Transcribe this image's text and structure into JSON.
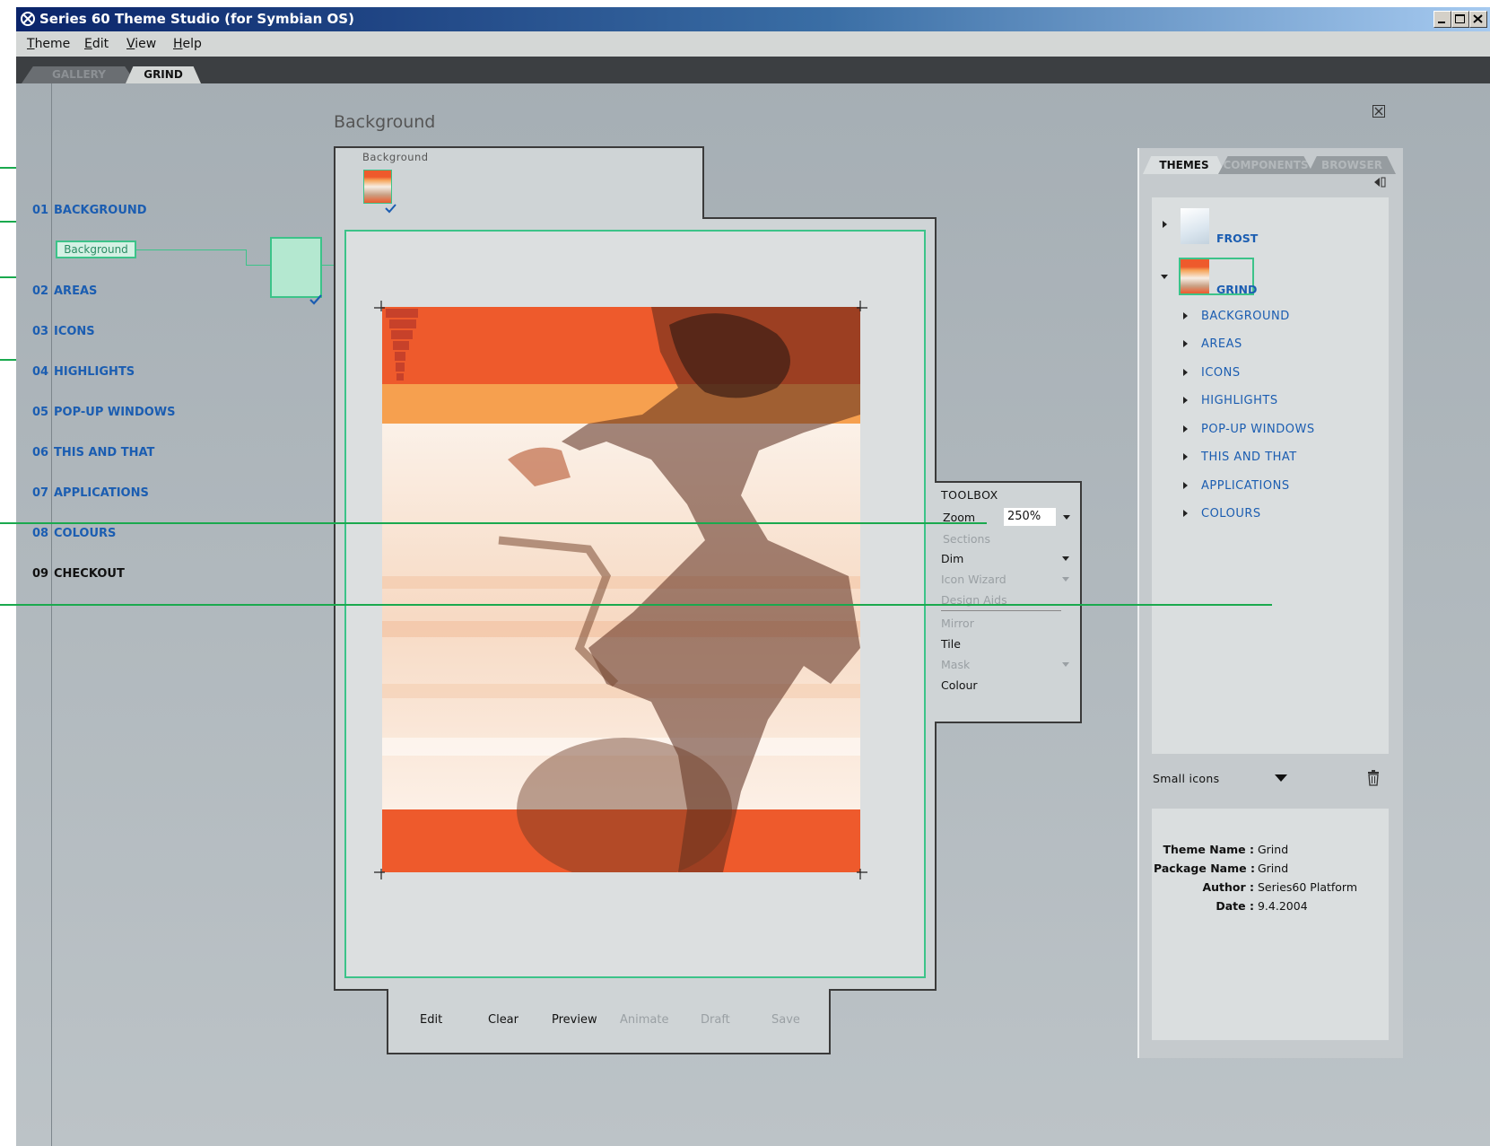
{
  "window": {
    "title": "Series 60 Theme Studio (for Symbian OS)"
  },
  "menu": [
    {
      "accel": "T",
      "rest": "heme"
    },
    {
      "accel": "E",
      "rest": "dit"
    },
    {
      "accel": "V",
      "rest": "iew"
    },
    {
      "accel": "H",
      "rest": "elp"
    }
  ],
  "doc_tabs": {
    "gallery": "GALLERY",
    "grind": "GRIND"
  },
  "nav": [
    {
      "num": "01",
      "label": "BACKGROUND"
    },
    {
      "num": "02",
      "label": "AREAS"
    },
    {
      "num": "03",
      "label": "ICONS"
    },
    {
      "num": "04",
      "label": "HIGHLIGHTS"
    },
    {
      "num": "05",
      "label": "POP-UP WINDOWS"
    },
    {
      "num": "06",
      "label": "THIS AND THAT"
    },
    {
      "num": "07",
      "label": "APPLICATIONS"
    },
    {
      "num": "08",
      "label": "COLOURS"
    },
    {
      "num": "09",
      "label": "CHECKOUT"
    }
  ],
  "tree_item": "Background",
  "page": {
    "heading": "Background",
    "thumb_label": "Background"
  },
  "toolbox": {
    "title": "TOOLBOX",
    "zoom_label": "Zoom",
    "zoom_value": "250%",
    "sections": "Sections",
    "dim": "Dim",
    "icon_wizard": "Icon Wizard",
    "design_aids": "Design Aids",
    "mirror": "Mirror",
    "tile": "Tile",
    "mask": "Mask",
    "colour": "Colour"
  },
  "bottom_buttons": {
    "edit": "Edit",
    "clear": "Clear",
    "preview": "Preview",
    "animate": "Animate",
    "draft": "Draft",
    "save": "Save"
  },
  "side_tabs": {
    "themes": "THEMES",
    "components": "COMPONENTS",
    "browser": "BROWSER"
  },
  "themes": [
    {
      "name": "FROST"
    },
    {
      "name": "GRIND"
    }
  ],
  "theme_sections": [
    "BACKGROUND",
    "AREAS",
    "ICONS",
    "HIGHLIGHTS",
    "POP-UP WINDOWS",
    "THIS AND THAT",
    "APPLICATIONS",
    "COLOURS"
  ],
  "view_mode": "Small icons",
  "info": [
    {
      "key": "Theme Name :",
      "value": "Grind"
    },
    {
      "key": "Package Name :",
      "value": "Grind"
    },
    {
      "key": "Author :",
      "value": "Series60 Platform"
    },
    {
      "key": "Date :",
      "value": "9.4.2004"
    }
  ],
  "colors": {
    "accent_blue": "#1b5db1",
    "selection_green": "#3cc389",
    "connector_green": "#1aa94e",
    "image_orange": "#ee5a2c"
  }
}
